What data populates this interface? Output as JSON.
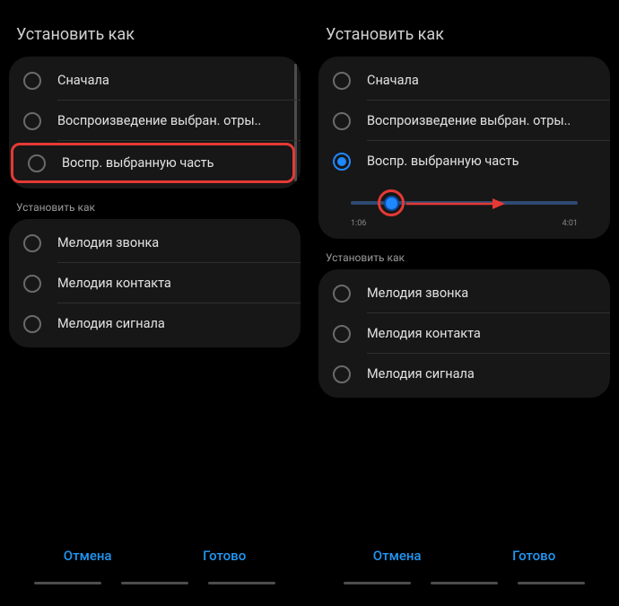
{
  "left": {
    "title": "Установить как",
    "group1": {
      "items": [
        {
          "label": "Сначала",
          "selected": false
        },
        {
          "label": "Воспроизведение выбран. отры..",
          "selected": false
        },
        {
          "label": "Воспр. выбранную часть",
          "selected": false,
          "highlighted": true
        }
      ]
    },
    "subTitle": "Установить как",
    "group2": {
      "items": [
        {
          "label": "Мелодия звонка",
          "selected": false
        },
        {
          "label": "Мелодия контакта",
          "selected": false
        },
        {
          "label": "Мелодия сигнала",
          "selected": false
        }
      ]
    },
    "buttons": {
      "cancel": "Отмена",
      "done": "Готово"
    }
  },
  "right": {
    "title": "Установить как",
    "group1": {
      "items": [
        {
          "label": "Сначала",
          "selected": false
        },
        {
          "label": "Воспроизведение выбран. отры..",
          "selected": false
        },
        {
          "label": "Воспр. выбранную часть",
          "selected": true
        }
      ],
      "slider": {
        "start": "1:06",
        "end": "4:01"
      }
    },
    "subTitle": "Установить как",
    "group2": {
      "items": [
        {
          "label": "Мелодия звонка",
          "selected": false
        },
        {
          "label": "Мелодия контакта",
          "selected": false
        },
        {
          "label": "Мелодия сигнала",
          "selected": false
        }
      ]
    },
    "buttons": {
      "cancel": "Отмена",
      "done": "Готово"
    }
  }
}
